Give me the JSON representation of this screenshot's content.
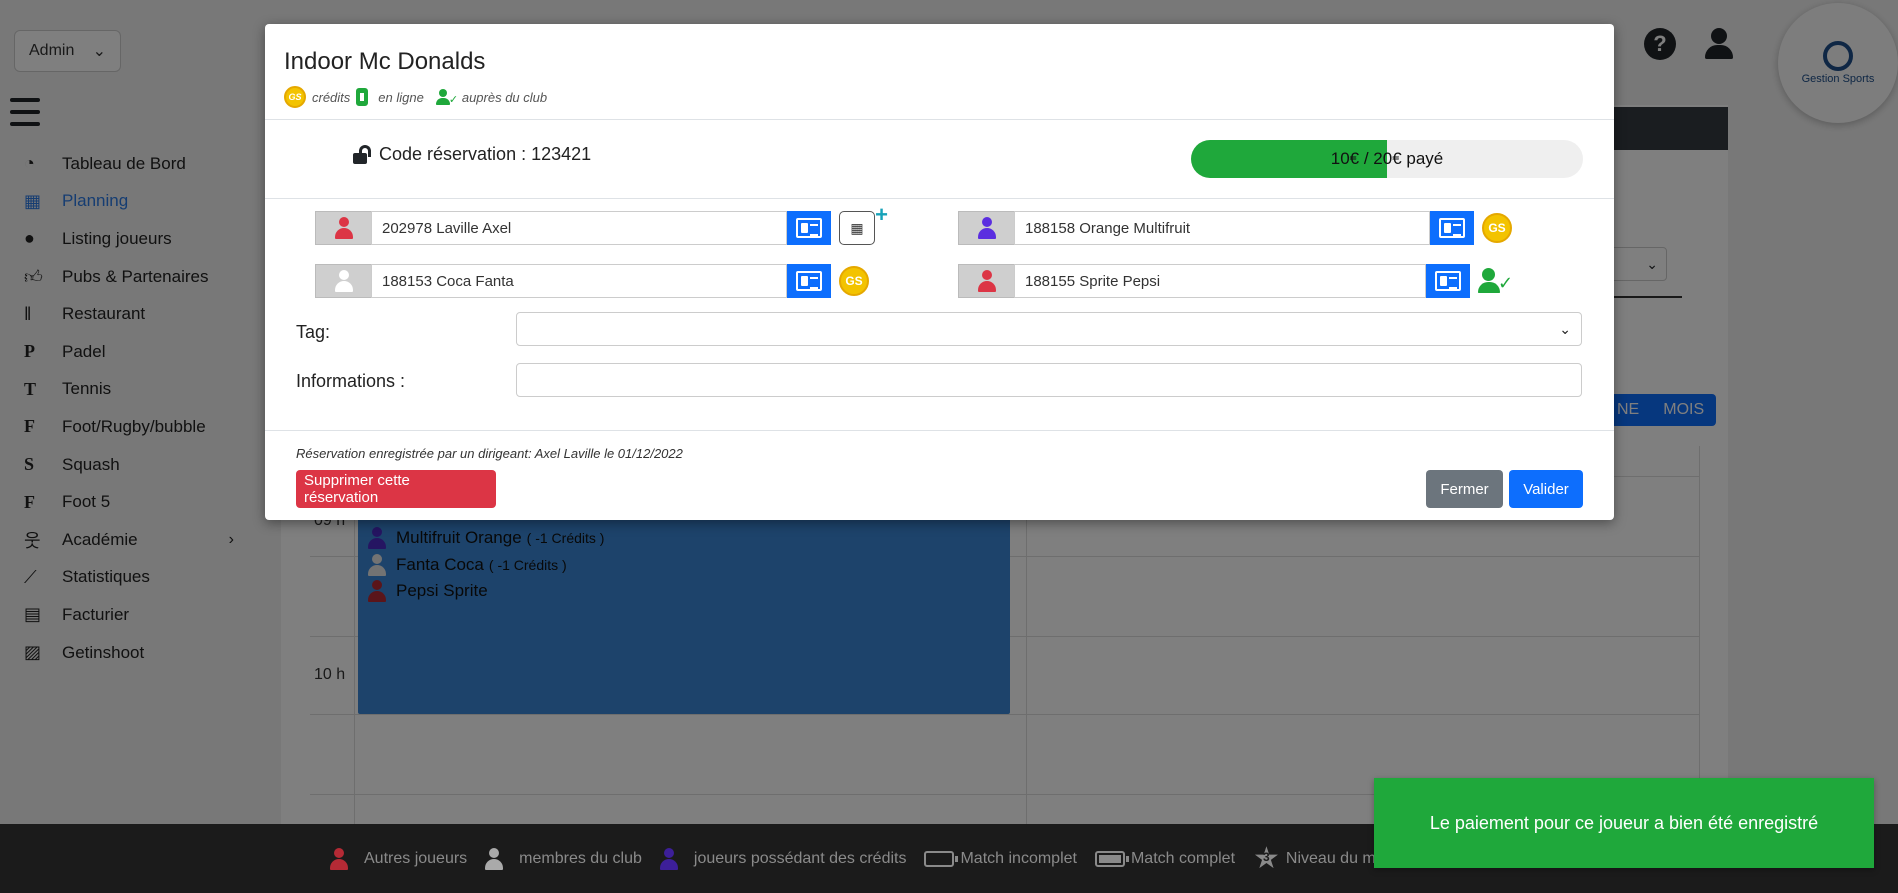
{
  "colors": {
    "primary": "#0d6efd",
    "success": "#1fa83b",
    "danger": "#dc3545",
    "secondary": "#6c757d",
    "player_red": "#dc3545",
    "player_white": "#ffffff",
    "player_purple": "#5b2ee0"
  },
  "top_bar": {
    "role": "Admin"
  },
  "logo": {
    "text": "Gestion Sports"
  },
  "sidebar": {
    "items": [
      {
        "label": "Tableau de Bord",
        "icon": "dashboard-icon"
      },
      {
        "label": "Planning",
        "icon": "calendar-icon",
        "active": true
      },
      {
        "label": "Listing joueurs",
        "icon": "user-icon"
      },
      {
        "label": "Pubs & Partenaires",
        "icon": "thumbs-up-icon"
      },
      {
        "label": "Restaurant",
        "icon": "utensils-icon"
      },
      {
        "label": "Padel",
        "icon": "letter-p-icon",
        "letter": "P"
      },
      {
        "label": "Tennis",
        "icon": "letter-t-icon",
        "letter": "T"
      },
      {
        "label": "Foot/Rugby/bubble",
        "icon": "letter-f-icon",
        "letter": "F"
      },
      {
        "label": "Squash",
        "icon": "letter-s-icon",
        "letter": "S"
      },
      {
        "label": "Foot 5",
        "icon": "letter-f-icon",
        "letter": "F"
      },
      {
        "label": "Académie",
        "icon": "child-icon",
        "has_submenu": true
      },
      {
        "label": "Statistiques",
        "icon": "chart-line-icon"
      },
      {
        "label": "Facturier",
        "icon": "invoice-icon"
      },
      {
        "label": "Getinshoot",
        "icon": "images-icon"
      }
    ]
  },
  "calendar": {
    "view_buttons": [
      "NE",
      "MOIS"
    ],
    "hours": [
      "09 h",
      "10 h"
    ],
    "event": {
      "lines": [
        {
          "name": "Multifruit Orange",
          "credits": "( -1 Crédits )",
          "color": "purple"
        },
        {
          "name": "Fanta Coca",
          "credits": "( -1 Crédits )",
          "color": "white"
        },
        {
          "name": "Pepsi Sprite",
          "credits": "",
          "color": "red"
        }
      ]
    }
  },
  "modal": {
    "title": "Indoor Mc Donalds",
    "legend": {
      "credits": "crédits",
      "online": "en ligne",
      "club": "auprès du club"
    },
    "code_label": "Code réservation : 123421",
    "payment": {
      "paid": 10,
      "total": 20,
      "label": "10€ / 20€ payé"
    },
    "players": [
      {
        "value": "202978 Laville Axel",
        "color": "red",
        "status": "register-payment"
      },
      {
        "value": "188158 Orange Multifruit",
        "color": "purple",
        "status": "credits"
      },
      {
        "value": "188153 Coca Fanta",
        "color": "white",
        "status": "credits"
      },
      {
        "value": "188155 Sprite Pepsi",
        "color": "red",
        "status": "club"
      }
    ],
    "tag_label": "Tag:",
    "tag_value": "",
    "info_label": "Informations :",
    "info_value": "",
    "footer_note": "Réservation enregistrée par un dirigeant: Axel Laville le 01/12/2022",
    "delete_label": "Supprimer cette réservation",
    "close_label": "Fermer",
    "validate_label": "Valider"
  },
  "legend_bar": {
    "items": [
      {
        "label": "Autres joueurs",
        "icon": "player-red-icon"
      },
      {
        "label": "membres du club",
        "icon": "player-white-icon"
      },
      {
        "label": "joueurs possédant des crédits",
        "icon": "player-purple-icon"
      },
      {
        "label": "Match incomplet",
        "icon": "battery-empty-icon"
      },
      {
        "label": "Match complet",
        "icon": "battery-full-icon"
      },
      {
        "label": "Niveau du match",
        "icon": "star-icon",
        "badge": "3"
      }
    ]
  },
  "toast": {
    "message": "Le paiement pour ce joueur a bien été enregistré"
  }
}
